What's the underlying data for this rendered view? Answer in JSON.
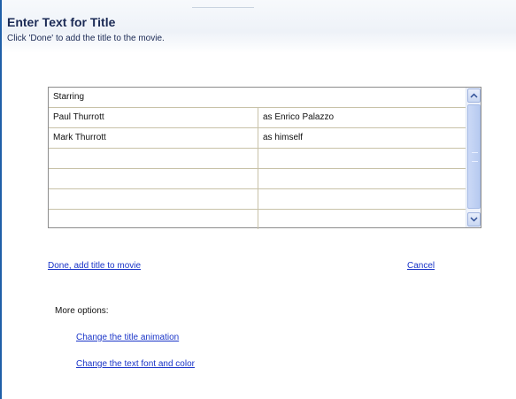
{
  "header": {
    "title": "Enter Text for Title",
    "subtitle": "Click 'Done' to add the title to the movie."
  },
  "table": {
    "heading": "Starring",
    "rows": [
      [
        "Paul Thurrott",
        "as Enrico Palazzo"
      ],
      [
        "Mark Thurrott",
        "as himself"
      ],
      [
        "",
        ""
      ],
      [
        "",
        ""
      ],
      [
        "",
        ""
      ],
      [
        "",
        ""
      ]
    ]
  },
  "actions": {
    "done": "Done, add title to movie",
    "cancel": "Cancel"
  },
  "more_options": {
    "label": "More options:",
    "animation": "Change the title animation",
    "font_color": "Change the text font and color"
  },
  "icons": {
    "scroll_up": "chevron-up-icon",
    "scroll_down": "chevron-down-icon"
  },
  "colors": {
    "link": "#1a35c8",
    "title": "#1b2a55"
  }
}
